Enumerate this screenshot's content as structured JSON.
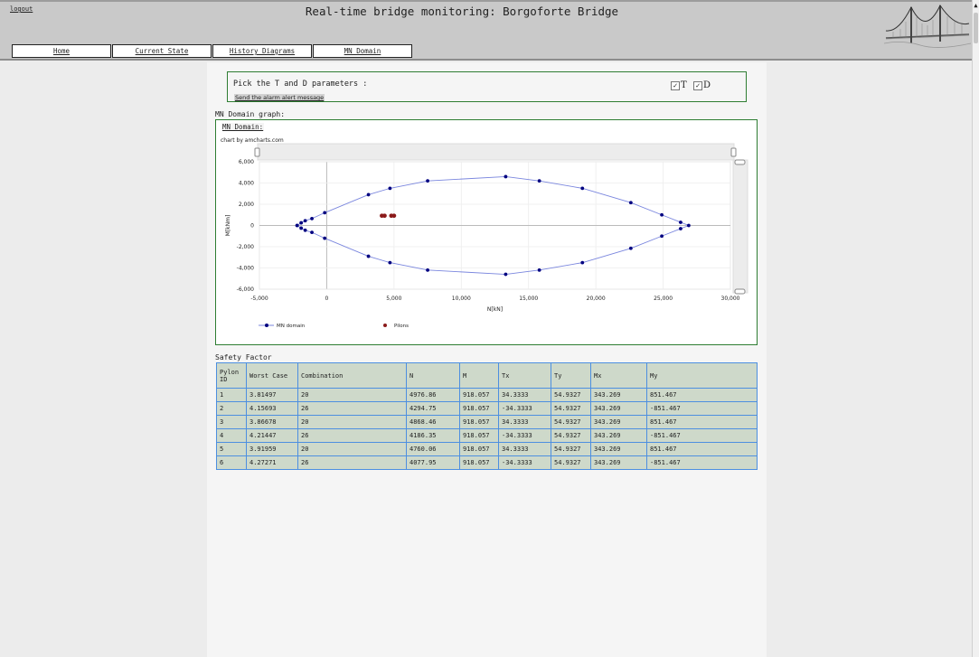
{
  "header": {
    "title": "Real-time bridge monitoring: Borgoforte Bridge",
    "logout_label": "logout",
    "logo_icon": "bridge-logo"
  },
  "nav": {
    "items": [
      {
        "label": "Home"
      },
      {
        "label": "Current State"
      },
      {
        "label": "History Diagrams"
      },
      {
        "label": "MN Domain"
      }
    ]
  },
  "params": {
    "label": "Pick the T and D parameters :",
    "alert_link": "Send the alarm alert message",
    "t_label": "T",
    "d_label": "D",
    "t_checked": true,
    "d_checked": true
  },
  "chart_section": {
    "heading": "MN Domain graph:",
    "title": "MN Domain:",
    "credit": "chart by amcharts.com"
  },
  "chart_data": {
    "type": "scatter",
    "xlabel": "N[kN]",
    "ylabel": "M[kNm]",
    "xlim": [
      -5000,
      30000
    ],
    "ylim": [
      -6000,
      6000
    ],
    "x_ticks": [
      "-5,000",
      "0",
      "5,000",
      "10,000",
      "15,000",
      "20,000",
      "25,000",
      "30,000"
    ],
    "y_ticks": [
      "6,000",
      "4,000",
      "2,000",
      "0",
      "-2,000",
      "-4,000",
      "-6,000"
    ],
    "grid": true,
    "legend_position": "bottom-left",
    "series": [
      {
        "name": "MN domain",
        "color": "#7a86de",
        "marker_color": "#000080",
        "points": [
          [
            -2200,
            0
          ],
          [
            -1900,
            250
          ],
          [
            -1600,
            450
          ],
          [
            -1100,
            650
          ],
          [
            -150,
            1200
          ],
          [
            3100,
            2900
          ],
          [
            4700,
            3500
          ],
          [
            7500,
            4200
          ],
          [
            13300,
            4600
          ],
          [
            15800,
            4200
          ],
          [
            19000,
            3500
          ],
          [
            22600,
            2150
          ],
          [
            24900,
            1000
          ],
          [
            26300,
            300
          ],
          [
            26900,
            0
          ],
          [
            26300,
            -300
          ],
          [
            24900,
            -1000
          ],
          [
            22600,
            -2150
          ],
          [
            19000,
            -3500
          ],
          [
            15800,
            -4200
          ],
          [
            13300,
            -4600
          ],
          [
            7500,
            -4200
          ],
          [
            4700,
            -3500
          ],
          [
            3100,
            -2900
          ],
          [
            -150,
            -1200
          ],
          [
            -1100,
            -650
          ],
          [
            -1600,
            -450
          ],
          [
            -1900,
            -250
          ],
          [
            -2200,
            0
          ]
        ]
      },
      {
        "name": "Pilons",
        "color": "#8b1a1a",
        "marker_color": "#8b1a1a",
        "points": [
          [
            4100,
            918
          ],
          [
            4300,
            918
          ],
          [
            4800,
            918
          ],
          [
            5000,
            918
          ]
        ]
      }
    ]
  },
  "safety": {
    "heading": "Safety Factor",
    "columns": [
      "Pylon ID",
      "Worst Case",
      "Combination",
      "N",
      "M",
      "Tx",
      "Ty",
      "Mx",
      "My"
    ],
    "rows": [
      [
        "1",
        "3.81497",
        "20",
        "4976.86",
        "918.057",
        "34.3333",
        "54.9327",
        "343.269",
        "851.467"
      ],
      [
        "2",
        "4.15693",
        "26",
        "4294.75",
        "918.057",
        "-34.3333",
        "54.9327",
        "343.269",
        "-851.467"
      ],
      [
        "3",
        "3.86678",
        "20",
        "4868.46",
        "918.057",
        "34.3333",
        "54.9327",
        "343.269",
        "851.467"
      ],
      [
        "4",
        "4.21447",
        "26",
        "4186.35",
        "918.057",
        "-34.3333",
        "54.9327",
        "343.269",
        "-851.467"
      ],
      [
        "5",
        "3.91959",
        "20",
        "4760.06",
        "918.057",
        "34.3333",
        "54.9327",
        "343.269",
        "851.467"
      ],
      [
        "6",
        "4.27271",
        "26",
        "4077.95",
        "918.057",
        "-34.3333",
        "54.9327",
        "343.269",
        "-851.467"
      ]
    ]
  }
}
